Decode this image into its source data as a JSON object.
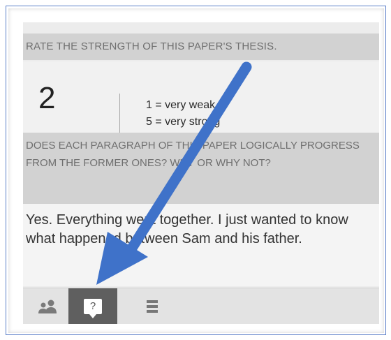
{
  "question1": {
    "title": "RATE THE STRENGTH OF THIS PAPER'S THESIS."
  },
  "rating": {
    "value": "2",
    "scale_low": "1 = very weak",
    "scale_high": "5 = very strong"
  },
  "question2": {
    "title": "DOES EACH PARAGRAPH OF THIS PAPER LOGICALLY PROGRESS FROM THE FORMER ONES? WHY OR WHY NOT?"
  },
  "answer2": {
    "text": "Yes. Everything went together. I just wanted to know what happened between Sam and his father."
  },
  "toolbar": {
    "help_label": "?",
    "active": "help",
    "icons": [
      "people-icon",
      "help-icon",
      "list-icon"
    ]
  },
  "colors": {
    "frame_border": "#5b7fc8",
    "header_bg": "#d2d2d2",
    "active_tab": "#5f5f5f",
    "arrow": "#3f72c9"
  }
}
